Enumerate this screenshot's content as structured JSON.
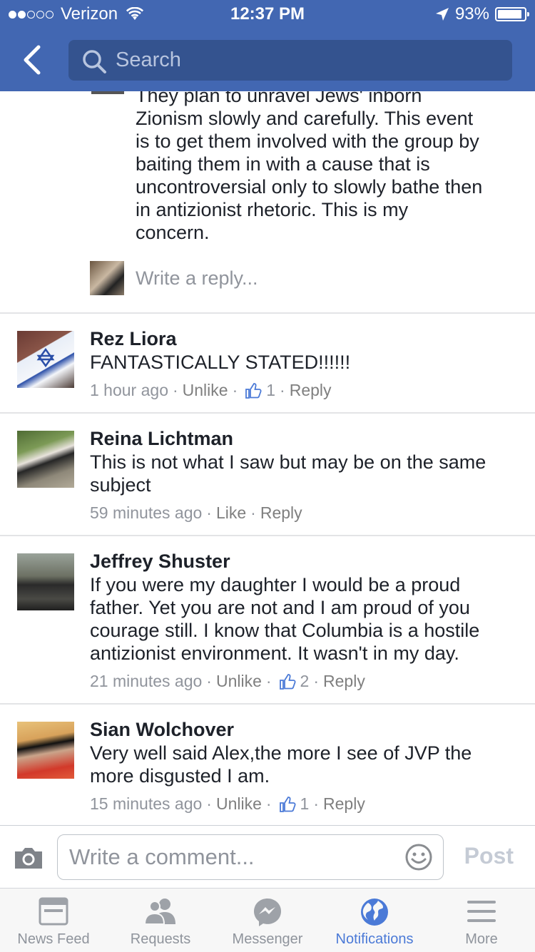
{
  "status": {
    "carrier": "Verizon",
    "time": "12:37 PM",
    "battery": "93%",
    "battery_level": 0.93
  },
  "search": {
    "placeholder": "Search"
  },
  "thread": {
    "continued_text_lines": [
      "They plan to unravel Jews' inborn",
      "Zionism slowly and carefully. This event",
      "is to get them involved with the group by",
      "baiting them in with a cause that is",
      "uncontroversial only to slowly bathe then",
      "in antizionist rhetoric. This is my",
      "concern."
    ],
    "reply_placeholder": "Write a reply..."
  },
  "comments": [
    {
      "name": "Rez Liora",
      "lines": [
        "FANTASTICALLY STATED!!!!!!"
      ],
      "time": "1 hour ago",
      "action": "Unlike",
      "likes": "1",
      "reply": "Reply"
    },
    {
      "name": "Reina Lichtman",
      "lines": [
        "This is not what I saw but may be on the same",
        "subject"
      ],
      "time": "59 minutes ago",
      "action": "Like",
      "likes": "",
      "reply": "Reply"
    },
    {
      "name": "Jeffrey Shuster",
      "lines": [
        "If you were my daughter I would be a proud",
        "father. Yet you are not and I am proud of you",
        "courage still. I know that Columbia is a hostile",
        "antizionist environment. It wasn't in my day."
      ],
      "time": "21 minutes ago",
      "action": "Unlike",
      "likes": "2",
      "reply": "Reply"
    },
    {
      "name": "Sian Wolchover",
      "lines": [
        "Very well said Alex,the more I see of JVP the",
        "more disgusted I am."
      ],
      "time": "15 minutes ago",
      "action": "Unlike",
      "likes": "1",
      "reply": "Reply"
    }
  ],
  "composer": {
    "placeholder": "Write a comment...",
    "post_label": "Post"
  },
  "tabs": [
    {
      "label": "News Feed",
      "icon": "news-feed-icon"
    },
    {
      "label": "Requests",
      "icon": "friend-requests-icon"
    },
    {
      "label": "Messenger",
      "icon": "messenger-icon"
    },
    {
      "label": "Notifications",
      "icon": "globe-icon"
    },
    {
      "label": "More",
      "icon": "hamburger-menu-icon"
    }
  ],
  "colors": {
    "brand": "#4267b2",
    "active_tab": "#4b7ad7",
    "meta_text": "#90949c"
  }
}
